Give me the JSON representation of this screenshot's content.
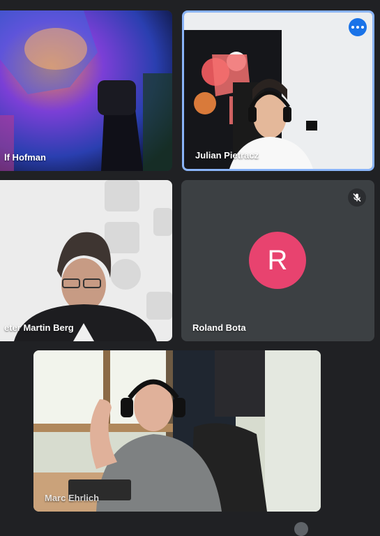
{
  "participants": [
    {
      "name": "Rolf Hofman",
      "display": "lf Hofman"
    },
    {
      "name": "Julian Pietracz"
    },
    {
      "name": "Peter Martin Berg",
      "display": "eter Martin Berg"
    },
    {
      "name": "Roland Bota",
      "avatar_letter": "R",
      "avatar_color": "#e8436f",
      "muted": true
    },
    {
      "name": "Marc Ehrlich"
    }
  ],
  "colors": {
    "background": "#202124",
    "tile": "#3c4043",
    "active_border": "#8ab4f8"
  }
}
